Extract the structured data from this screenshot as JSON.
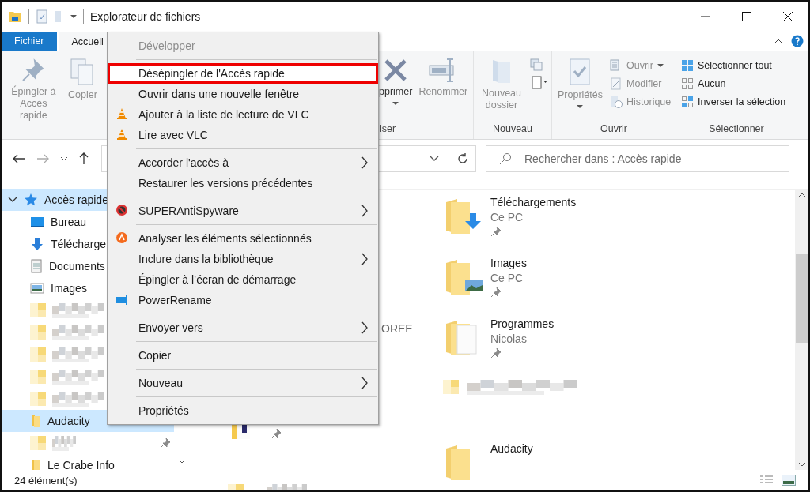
{
  "window": {
    "title": "Explorateur de fichiers"
  },
  "ribbon": {
    "tabs": [
      {
        "label": "Fichier",
        "kind": "file",
        "selected": false
      },
      {
        "label": "Accueil",
        "kind": "tab",
        "selected": true
      }
    ],
    "clipboard": [
      {
        "label": "Épingler à Accès rapide",
        "disabled": true
      },
      {
        "label": "Copier",
        "disabled": true
      }
    ],
    "organize": {
      "label": "iser",
      "buttons": [
        {
          "label": "pprimer",
          "disabled": false,
          "dropdown": true
        },
        {
          "label": "Renommer",
          "disabled": true,
          "dropdown": false
        }
      ]
    },
    "new": {
      "label": "Nouveau",
      "button": {
        "label": "Nouveau dossier",
        "disabled": true
      }
    },
    "open": {
      "label": "Ouvrir",
      "button": {
        "label": "Propriétés",
        "disabled": true
      },
      "items": [
        {
          "label": "Ouvrir",
          "disabled": true,
          "dropdown": true
        },
        {
          "label": "Modifier",
          "disabled": true,
          "dropdown": false
        },
        {
          "label": "Historique",
          "disabled": true,
          "dropdown": false
        }
      ]
    },
    "select": {
      "label": "Sélectionner",
      "items": [
        {
          "label": "Sélectionner tout",
          "disabled": false
        },
        {
          "label": "Aucun",
          "disabled": false
        },
        {
          "label": "Inverser la sélection",
          "disabled": false
        }
      ]
    }
  },
  "search": {
    "placeholder": "Rechercher dans : Accès rapide"
  },
  "nav": {
    "items": [
      {
        "kind": "quick",
        "label": "Accès rapide",
        "selected": true,
        "expanded": true
      },
      {
        "kind": "desktop",
        "label": "Bureau",
        "selected": false
      },
      {
        "kind": "downloads",
        "label": "Télécharge",
        "selected": false
      },
      {
        "kind": "documents",
        "label": "Documents",
        "selected": false
      },
      {
        "kind": "pictures",
        "label": "Images",
        "selected": false
      },
      {
        "kind": "redacted",
        "selected": false,
        "pinned": false
      },
      {
        "kind": "redacted",
        "selected": false,
        "pinned": false
      },
      {
        "kind": "redacted",
        "selected": false,
        "pinned": false
      },
      {
        "kind": "redacted",
        "selected": false,
        "pinned": false
      },
      {
        "kind": "redacted",
        "selected": false,
        "pinned": false
      },
      {
        "kind": "folder",
        "label": "Audacity",
        "selected": true
      },
      {
        "kind": "redacted",
        "selected": false,
        "pinned": true
      },
      {
        "kind": "folder",
        "label": "Le Crabe Info",
        "selected": false
      }
    ]
  },
  "content": {
    "column_1": [
      {
        "kind": "covered"
      },
      {
        "kind": "covered"
      },
      {
        "kind": "text",
        "label": "OREE"
      },
      {
        "kind": "folder",
        "pinned": true
      },
      {
        "kind": "redacted"
      }
    ],
    "column_2": [
      {
        "kind": "downloads-folder",
        "name": "Téléchargements",
        "location": "Ce PC",
        "pinned": true
      },
      {
        "kind": "pictures-folder",
        "name": "Images",
        "location": "Ce PC",
        "pinned": true
      },
      {
        "kind": "documents-folder",
        "name": "Programmes",
        "location": "Nicolas",
        "pinned": true
      },
      {
        "kind": "redacted"
      },
      {
        "kind": "folder",
        "name": "Audacity"
      }
    ]
  },
  "context_menu": [
    {
      "kind": "plain",
      "label": "Développer",
      "disabled": true,
      "highlighted": false,
      "submenu": false
    },
    {
      "kind": "separator"
    },
    {
      "kind": "plain",
      "label": "Désépingler de l'Accès rapide",
      "disabled": false,
      "highlighted": true,
      "submenu": false
    },
    {
      "kind": "plain",
      "label": "Ouvrir dans une nouvelle fenêtre",
      "disabled": false,
      "highlighted": false,
      "submenu": false
    },
    {
      "kind": "vlc",
      "label": "Ajouter à la liste de lecture de VLC",
      "disabled": false,
      "highlighted": false,
      "submenu": false
    },
    {
      "kind": "vlc",
      "label": "Lire avec VLC",
      "disabled": false,
      "highlighted": false,
      "submenu": false
    },
    {
      "kind": "separator"
    },
    {
      "kind": "plain",
      "label": "Accorder l'accès à",
      "disabled": false,
      "highlighted": false,
      "submenu": true
    },
    {
      "kind": "plain",
      "label": "Restaurer les versions précédentes",
      "disabled": false,
      "highlighted": false,
      "submenu": false
    },
    {
      "kind": "separator"
    },
    {
      "kind": "antispyware",
      "label": "SUPERAntiSpyware",
      "disabled": false,
      "highlighted": false,
      "submenu": true
    },
    {
      "kind": "separator"
    },
    {
      "kind": "antivirus",
      "label": "Analyser les éléments sélectionnés",
      "disabled": false,
      "highlighted": false,
      "submenu": false
    },
    {
      "kind": "plain",
      "label": "Inclure dans la bibliothèque",
      "disabled": false,
      "highlighted": false,
      "submenu": true
    },
    {
      "kind": "plain",
      "label": "Épingler à l’écran de démarrage",
      "disabled": false,
      "highlighted": false,
      "submenu": false
    },
    {
      "kind": "powerrename",
      "label": "PowerRename",
      "disabled": false,
      "highlighted": false,
      "submenu": false
    },
    {
      "kind": "separator"
    },
    {
      "kind": "plain",
      "label": "Envoyer vers",
      "disabled": false,
      "highlighted": false,
      "submenu": true
    },
    {
      "kind": "separator"
    },
    {
      "kind": "plain",
      "label": "Copier",
      "disabled": false,
      "highlighted": false,
      "submenu": false
    },
    {
      "kind": "separator"
    },
    {
      "kind": "plain",
      "label": "Nouveau",
      "disabled": false,
      "highlighted": false,
      "submenu": true
    },
    {
      "kind": "separator"
    },
    {
      "kind": "plain",
      "label": "Propriétés",
      "disabled": false,
      "highlighted": false,
      "submenu": false
    }
  ],
  "status_bar": {
    "count": "24 élément(s)"
  }
}
